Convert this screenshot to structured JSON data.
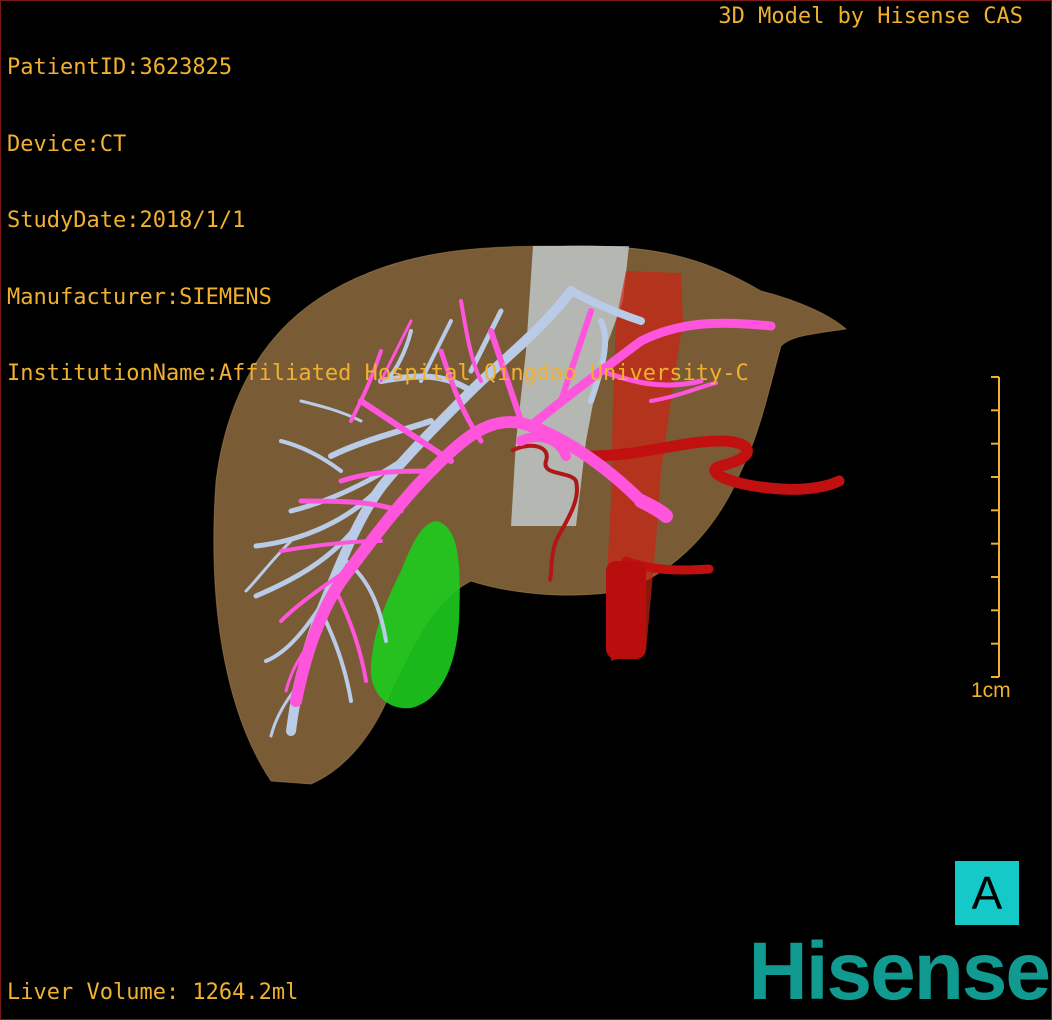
{
  "header": {
    "patient_id": "PatientID:3623825",
    "device": "Device:CT",
    "study_date": "StudyDate:2018/1/1",
    "manufacturer": "Manufacturer:SIEMENS",
    "institution": "InstitutionName:Affiliated Hospital Qingdao University-C",
    "model_credit": "3D Model by Hisense CAS"
  },
  "footer": {
    "liver_volume": "Liver Volume: 1264.2ml",
    "logo_text": "Hisense"
  },
  "scale": {
    "label": "1cm",
    "tick_count": 10
  },
  "orientation": {
    "label": "A",
    "color": "#15c9c9"
  },
  "colors": {
    "overlay_text": "#f0b030",
    "liver": "#a8804a",
    "portal_vein": "#ff55dd",
    "hepatic_vein": "#b9cbe6",
    "artery": "#c01010",
    "gallbladder": "#1dcc1d",
    "ivc": "#d9efff",
    "logo": "#109a90"
  },
  "structures": [
    "liver",
    "portal-vein",
    "hepatic-vein",
    "hepatic-artery",
    "aorta",
    "inferior-vena-cava",
    "gallbladder"
  ]
}
